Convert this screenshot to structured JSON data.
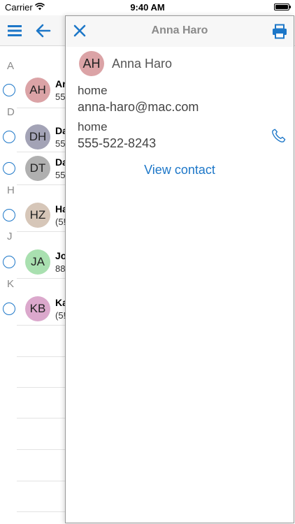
{
  "status_bar": {
    "carrier": "Carrier",
    "time": "9:40 AM"
  },
  "list": {
    "sections": [
      "A",
      "D",
      "H",
      "J",
      "K"
    ],
    "rows": [
      {
        "initials": "AH",
        "name": "Ar",
        "sub": "55",
        "avatar_color": "#dba3a6"
      },
      {
        "initials": "DH",
        "name": "Da",
        "sub": "55",
        "avatar_color": "#a3a3b6"
      },
      {
        "initials": "DT",
        "name": "Da",
        "sub": "55",
        "avatar_color": "#b0b0b0"
      },
      {
        "initials": "HZ",
        "name": "Ha",
        "sub": "(5!",
        "avatar_color": "#d6c6b8"
      },
      {
        "initials": "JA",
        "name": "Jo",
        "sub": "88",
        "avatar_color": "#a9e0b0"
      },
      {
        "initials": "KB",
        "name": "Ka",
        "sub": "(5!",
        "avatar_color": "#dba8cc"
      }
    ]
  },
  "panel": {
    "title": "Anna Haro",
    "contact": {
      "initials": "AH",
      "name": "Anna Haro",
      "avatar_color": "#dba3a6"
    },
    "email": {
      "label": "home",
      "value": "anna-haro@mac.com"
    },
    "phone": {
      "label": "home",
      "value": "555-522-8243"
    },
    "view_contact_label": "View contact"
  },
  "colors": {
    "accent": "#1d77c8",
    "title_gray": "#8a8a8a"
  }
}
